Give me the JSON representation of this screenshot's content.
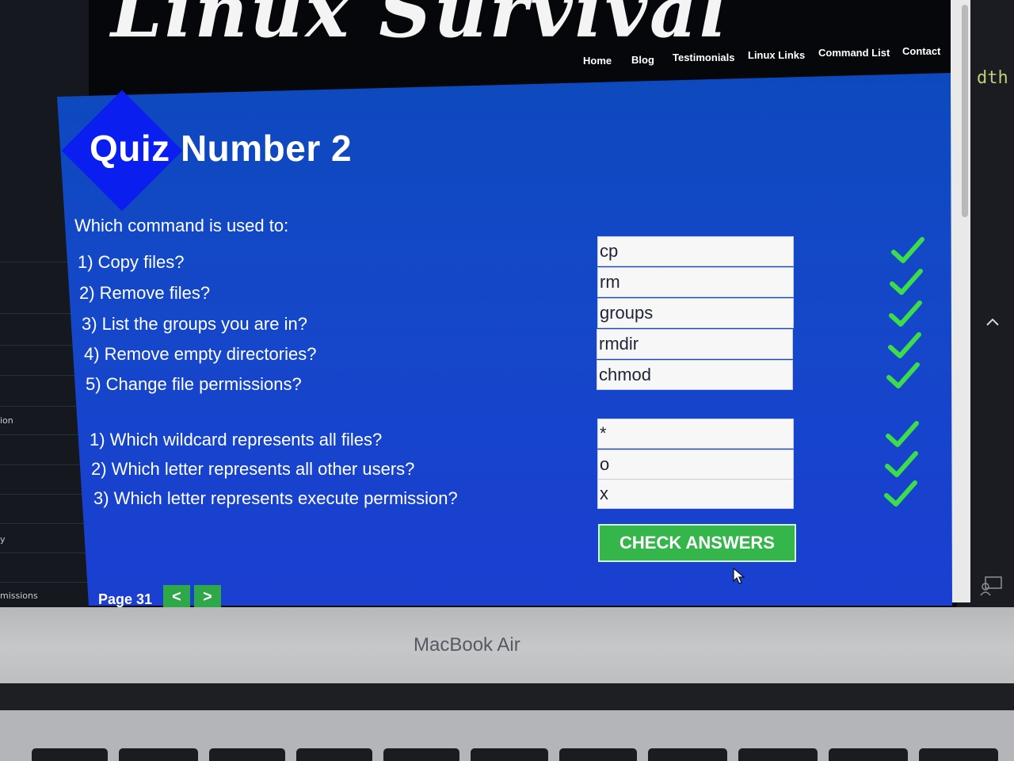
{
  "site": {
    "logo_text": "Linux Survival",
    "nav": [
      {
        "label": "Home"
      },
      {
        "label": "Blog"
      },
      {
        "label": "Testimonials"
      },
      {
        "label": "Linux Links"
      },
      {
        "label": "Command List"
      },
      {
        "label": "Contact"
      }
    ]
  },
  "quiz": {
    "title": "Quiz Number 2",
    "intro": "Which command is used to:",
    "group1": [
      {
        "question": "1) Copy files?",
        "answer": "cp",
        "correct": true
      },
      {
        "question": "2) Remove files?",
        "answer": "rm",
        "correct": true
      },
      {
        "question": "3) List the groups you are in?",
        "answer": "groups",
        "correct": true
      },
      {
        "question": "4) Remove empty directories?",
        "answer": "rmdir",
        "correct": true
      },
      {
        "question": "5) Change file permissions?",
        "answer": "chmod",
        "correct": true
      }
    ],
    "group2": [
      {
        "question": "1) Which wildcard represents all files?",
        "answer": "*",
        "correct": true
      },
      {
        "question": "2) Which letter represents all other users?",
        "answer": "o",
        "correct": true
      },
      {
        "question": "3) Which letter represents execute permission?",
        "answer": "x",
        "correct": true
      }
    ],
    "check_button": "CHECK ANSWERS",
    "page_label": "Page 31",
    "prev_label": "<",
    "next_label": ">"
  },
  "editor": {
    "left_labels": [
      "ion",
      "y",
      "missions"
    ],
    "right_code": "dth"
  },
  "device": {
    "brand": "MacBook Air"
  },
  "colors": {
    "panel_blue": "#1547c9",
    "diamond_blue": "#0a1ef0",
    "check_green": "#35b64b",
    "tick_green": "#3ddc4a"
  }
}
